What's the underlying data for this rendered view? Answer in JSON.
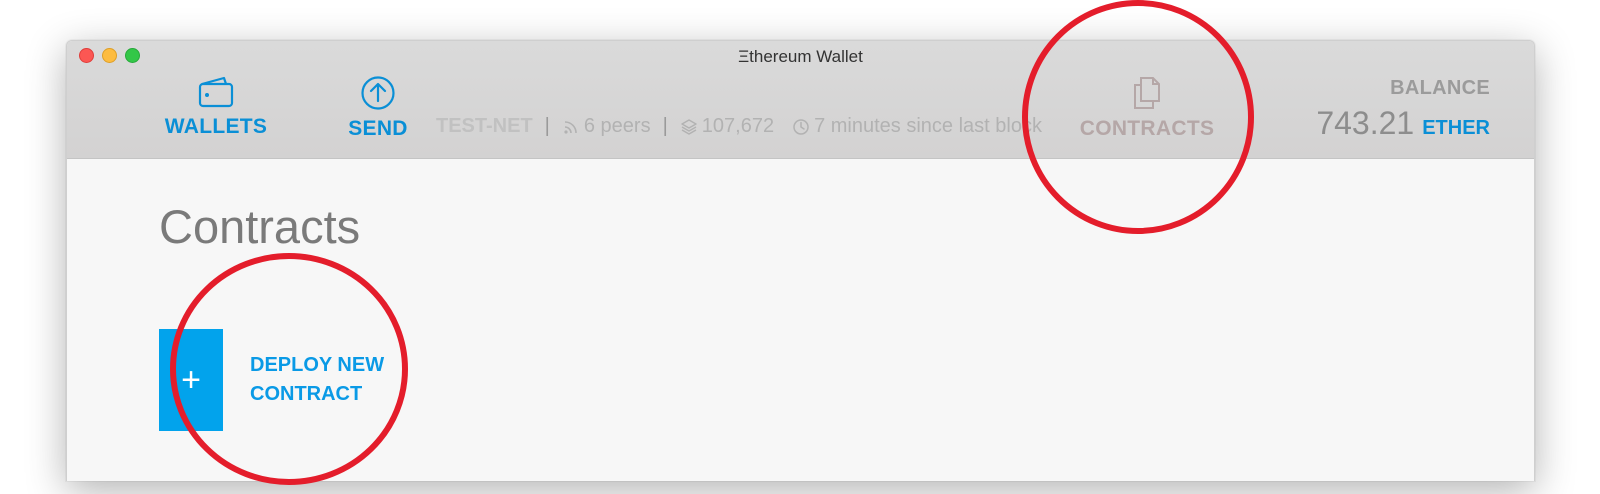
{
  "window": {
    "title": "Ξthereum Wallet"
  },
  "nav": {
    "wallets_label": "WALLETS",
    "send_label": "SEND",
    "contracts_label": "CONTRACTS"
  },
  "status": {
    "network": "TEST-NET",
    "peers": "6 peers",
    "block": "107,672",
    "last_block": "7 minutes since last block"
  },
  "balance": {
    "label": "BALANCE",
    "amount": "743.21",
    "unit": "ETHER"
  },
  "main": {
    "title": "Contracts",
    "deploy_symbol": "+",
    "deploy_label_line1": "DEPLOY NEW",
    "deploy_label_line2": "CONTRACT"
  },
  "icons": {
    "wallet": "wallet-icon",
    "send": "arrow-up-circle-icon",
    "contracts": "documents-icon",
    "peers": "signal-icon",
    "blocks": "layers-icon",
    "time": "clock-icon"
  },
  "colors": {
    "accent": "#0a8fd6",
    "deploy_button": "#02a3ec",
    "annotation_circle": "#e41d2b",
    "header_bg": "#d6d5d5"
  }
}
